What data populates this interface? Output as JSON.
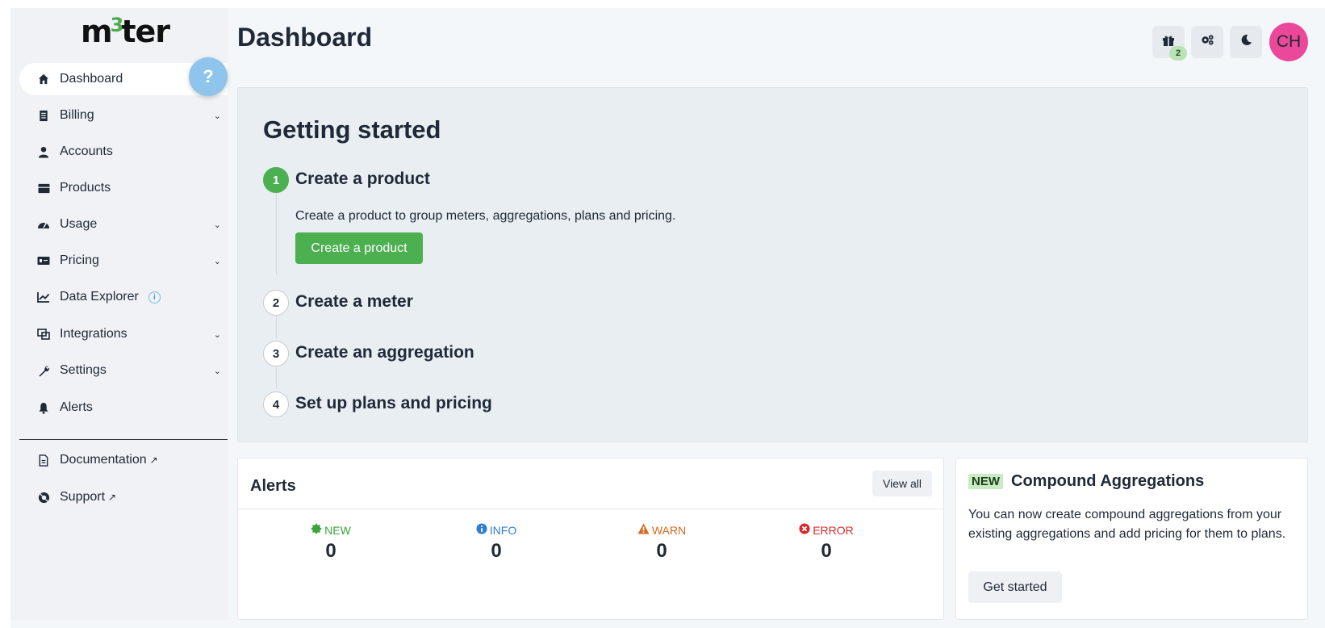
{
  "app": {
    "logo_text_a": "m",
    "logo_sup": "3",
    "logo_text_b": "ter"
  },
  "sidebar": {
    "items": [
      {
        "label": "Dashboard",
        "icon": "home-icon",
        "active": true
      },
      {
        "label": "Billing",
        "icon": "receipt-icon",
        "has_chevron": true
      },
      {
        "label": "Accounts",
        "icon": "user-icon"
      },
      {
        "label": "Products",
        "icon": "box-icon"
      },
      {
        "label": "Usage",
        "icon": "gauge-icon",
        "has_chevron": true
      },
      {
        "label": "Pricing",
        "icon": "money-icon",
        "has_chevron": true
      },
      {
        "label": "Data Explorer",
        "icon": "chart-line-icon",
        "info": "i"
      },
      {
        "label": "Integrations",
        "icon": "integrations-icon",
        "has_chevron": true
      },
      {
        "label": "Settings",
        "icon": "wrench-icon",
        "has_chevron": true
      },
      {
        "label": "Alerts",
        "icon": "bell-icon"
      }
    ],
    "footer_items": [
      {
        "label": "Documentation",
        "icon": "document-icon"
      },
      {
        "label": "Support",
        "icon": "lifebuoy-icon"
      }
    ]
  },
  "header": {
    "title": "Dashboard",
    "gift_badge": "2",
    "avatar_initials": "CH"
  },
  "getting_started": {
    "title": "Getting started",
    "steps": [
      {
        "number": "1",
        "title": "Create a product",
        "active": true
      },
      {
        "number": "2",
        "title": "Create a meter"
      },
      {
        "number": "3",
        "title": "Create an aggregation"
      },
      {
        "number": "4",
        "title": "Set up plans and pricing"
      }
    ],
    "active_desc": "Create a product to group meters, aggregations, plans and pricing.",
    "create_button": "Create a product"
  },
  "alerts": {
    "title": "Alerts",
    "view_all": "View all",
    "counts": [
      {
        "label": "NEW",
        "value": "0",
        "color": "#3aa33a"
      },
      {
        "label": "INFO",
        "value": "0",
        "color": "#2f7fd1"
      },
      {
        "label": "WARN",
        "value": "0",
        "color": "#d9691f"
      },
      {
        "label": "ERROR",
        "value": "0",
        "color": "#d82a2a"
      }
    ]
  },
  "compound": {
    "tag": "NEW",
    "title": "Compound Aggregations",
    "body": "You can now create compound aggregations from your existing aggregations and add pricing for them to plans.",
    "button": "Get started"
  }
}
